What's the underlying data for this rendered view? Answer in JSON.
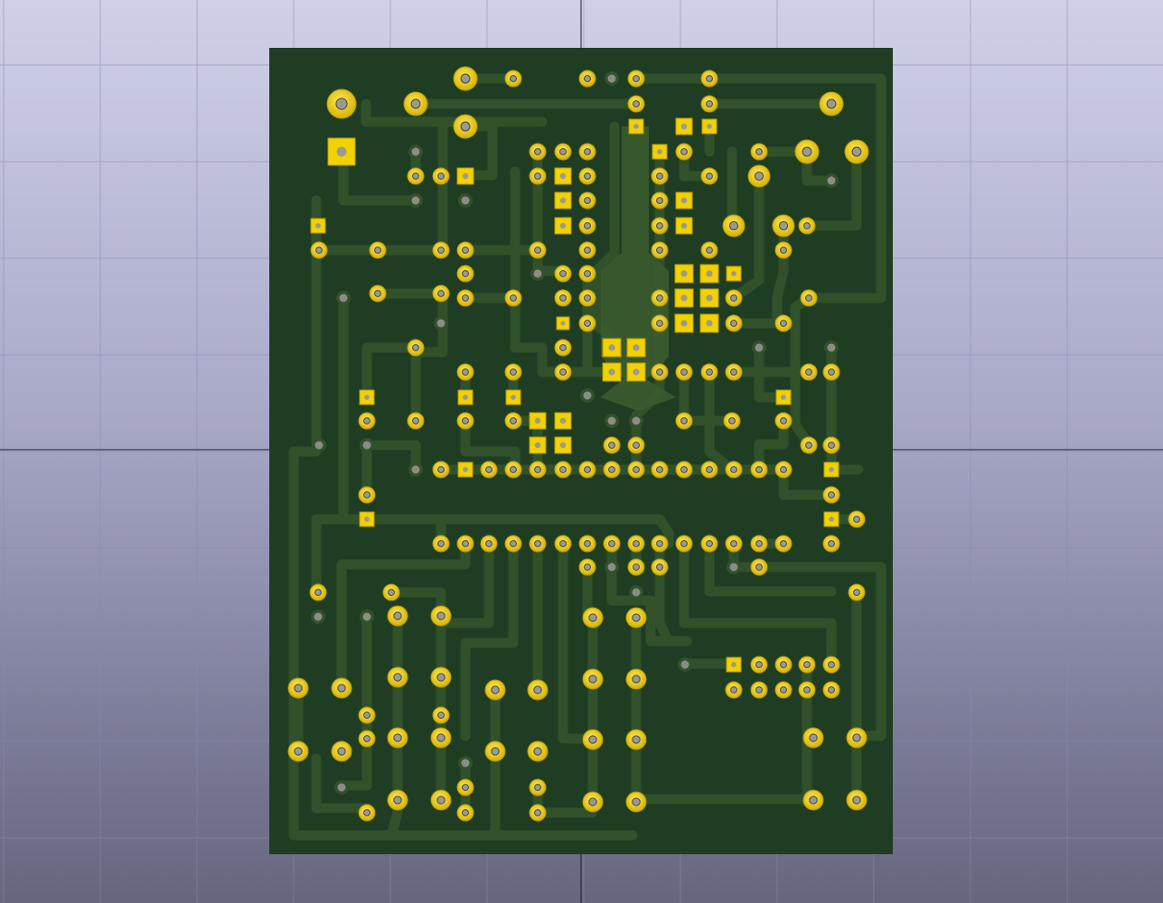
{
  "view": {
    "kind": "3d-pcb-viewer",
    "background_top": "#cfd0e8",
    "background_bottom": "#66667f",
    "grid_color": "#8a8ab0",
    "axis_color": "#1e1e2e"
  },
  "board": {
    "substrate_color": "#1f3d22",
    "trace_color": "#31512b",
    "pad_color": "#f2d100",
    "drill_color": "#9a9a90",
    "label": ""
  }
}
